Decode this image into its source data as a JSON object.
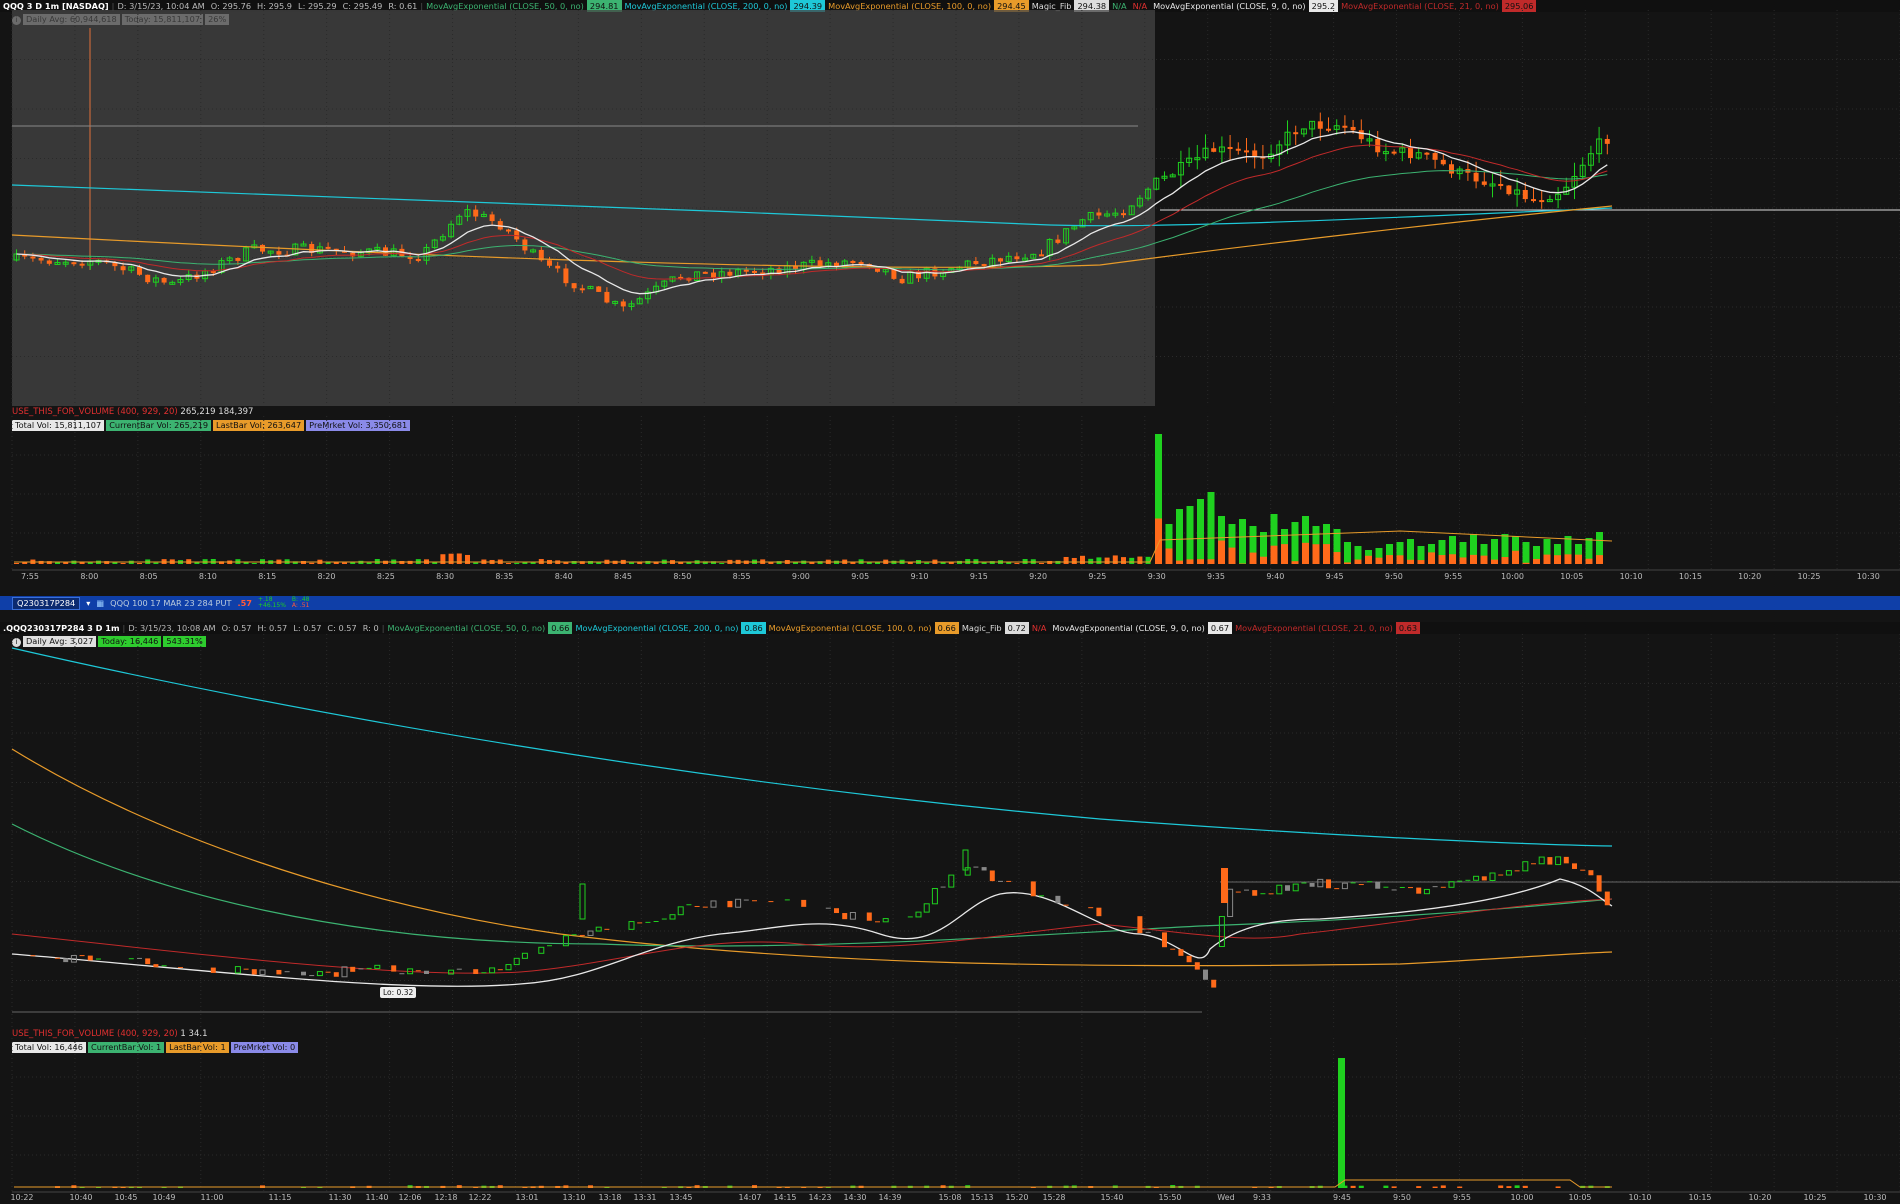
{
  "colors": {
    "bg": "#141414",
    "ema50": "#3cb371",
    "ema200": "#1ec8d8",
    "ema100": "#e89b2a",
    "ema9": "#e8e8e8",
    "ema21": "#c02a2a",
    "up": "#1fd11f",
    "down": "#ff6a1a",
    "premarket_shade": "#444444"
  },
  "top_chart": {
    "header": {
      "symbol": "QQQ 3 D 1m [NASDAQ]",
      "date": "D: 3/15/23, 10:04 AM",
      "open": "O: 295.76",
      "high": "H: 295.9",
      "low": "L: 295.29",
      "close": "C: 295.49",
      "range": "R: 0.61",
      "studies": [
        {
          "label": "MovAvgExponential (CLOSE, 50, 0, no)",
          "value": "294.81",
          "color": "#3cb371"
        },
        {
          "label": "MovAvgExponential (CLOSE, 200, 0, no)",
          "value": "294.39",
          "color": "#1ec8d8"
        },
        {
          "label": "MovAvgExponential (CLOSE, 100, 0, no)",
          "value": "294.45",
          "color": "#e89b2a"
        },
        {
          "label": "Magic_Fib",
          "value": "294.38",
          "color": "#dddddd"
        },
        {
          "label": "N/A",
          "value": "",
          "color": "#3cb371"
        },
        {
          "label": "N/A",
          "value": "",
          "color": "#e03030"
        },
        {
          "label": "MovAvgExponential (CLOSE, 9, 0, no)",
          "value": "295.2",
          "color": "#e8e8e8"
        },
        {
          "label": "MovAvgExponential (CLOSE, 21, 0, no)",
          "value": "295.06",
          "color": "#c02a2a"
        }
      ]
    },
    "info_badges": [
      {
        "text": "Daily Avg: 60,944,618",
        "bg": "#e0e0e0",
        "fg": "#111"
      },
      {
        "text": "Today: 15,811,107",
        "bg": "#e0e0e0",
        "fg": "#111"
      },
      {
        "text": "26%",
        "bg": "#e0e0e0",
        "fg": "#111"
      }
    ]
  },
  "top_volume": {
    "header": {
      "label": "USE_THIS_FOR_VOLUME (400, 929, 20)",
      "v1": "265,219",
      "v2": "184,397"
    },
    "badges": [
      {
        "text": "Total Vol: 15,811,107",
        "bg": "#e8e8e8",
        "fg": "#111"
      },
      {
        "text": "CurrentBar Vol: 265,219",
        "bg": "#3cb371",
        "fg": "#111"
      },
      {
        "text": "LastBar Vol: 263,647",
        "bg": "#e89b2a",
        "fg": "#111"
      },
      {
        "text": "PreMrket Vol: 3,350,681",
        "bg": "#8a8ae8",
        "fg": "#111"
      }
    ],
    "time_axis": [
      "7:55",
      "8:00",
      "8:05",
      "8:10",
      "8:15",
      "8:20",
      "8:25",
      "8:30",
      "8:35",
      "8:40",
      "8:45",
      "8:50",
      "8:55",
      "9:00",
      "9:05",
      "9:10",
      "9:15",
      "9:20",
      "9:25",
      "9:30",
      "9:35",
      "9:40",
      "9:45",
      "9:50",
      "9:55",
      "10:00",
      "10:05",
      "10:10",
      "10:15",
      "10:20",
      "10:25",
      "10:30"
    ]
  },
  "symbol_bar": {
    "symbol_input": "Q230317P284",
    "description": "QQQ 100 17 MAR 23 284 PUT",
    "price": ".57",
    "change_top": "+.18",
    "change_bottom": "+46.15%",
    "bid": "B: .48",
    "ask": "A: .51"
  },
  "bottom_chart": {
    "header": {
      "symbol": ".QQQ230317P284 3 D 1m",
      "date": "D: 3/15/23, 10:08 AM",
      "open": "O: 0.57",
      "high": "H: 0.57",
      "low": "L: 0.57",
      "close": "C: 0.57",
      "range": "R: 0",
      "studies": [
        {
          "label": "MovAvgExponential (CLOSE, 50, 0, no)",
          "value": "0.66",
          "color": "#3cb371"
        },
        {
          "label": "MovAvgExponential (CLOSE, 200, 0, no)",
          "value": "0.86",
          "color": "#1ec8d8"
        },
        {
          "label": "MovAvgExponential (CLOSE, 100, 0, no)",
          "value": "0.66",
          "color": "#e89b2a"
        },
        {
          "label": "Magic_Fib",
          "value": "0.72",
          "color": "#dddddd"
        },
        {
          "label": "N/A",
          "value": "",
          "color": "#e03030"
        },
        {
          "label": "MovAvgExponential (CLOSE, 9, 0, no)",
          "value": "0.67",
          "color": "#e8e8e8"
        },
        {
          "label": "MovAvgExponential (CLOSE, 21, 0, no)",
          "value": "0.63",
          "color": "#c02a2a"
        }
      ]
    },
    "info_badges": [
      {
        "text": "Daily Avg: 3,027",
        "bg": "#e0e0e0",
        "fg": "#111"
      },
      {
        "text": "Today: 16,446",
        "bg": "#2ecc2e",
        "fg": "#111"
      },
      {
        "text": "543.31%",
        "bg": "#2ecc2e",
        "fg": "#111"
      }
    ],
    "low_label": "Lo: 0.32"
  },
  "bottom_volume": {
    "header": {
      "label": "USE_THIS_FOR_VOLUME (400, 929, 20)",
      "v1": "1",
      "v2": "34.1"
    },
    "badges": [
      {
        "text": "Total Vol: 16,446",
        "bg": "#e8e8e8",
        "fg": "#111"
      },
      {
        "text": "CurrentBar Vol: 1",
        "bg": "#3cb371",
        "fg": "#111"
      },
      {
        "text": "LastBar Vol: 1",
        "bg": "#e89b2a",
        "fg": "#111"
      },
      {
        "text": "PreMrket Vol: 0",
        "bg": "#8a8ae8",
        "fg": "#111"
      }
    ],
    "time_axis": [
      "10:22",
      "10:40",
      "10:45",
      "10:49",
      "11:00",
      "11:15",
      "11:30",
      "11:40",
      "12:06",
      "12:18",
      "12:22",
      "13:01",
      "13:10",
      "13:18",
      "13:31",
      "13:45",
      "14:07",
      "14:15",
      "14:23",
      "14:30",
      "14:39",
      "15:08",
      "15:13",
      "15:20",
      "15:28",
      "15:40",
      "15:50",
      "Wed",
      "9:33",
      "9:45",
      "9:50",
      "9:55",
      "10:00",
      "10:05",
      "10:10",
      "10:15",
      "10:20",
      "10:25",
      "10:30"
    ]
  }
}
